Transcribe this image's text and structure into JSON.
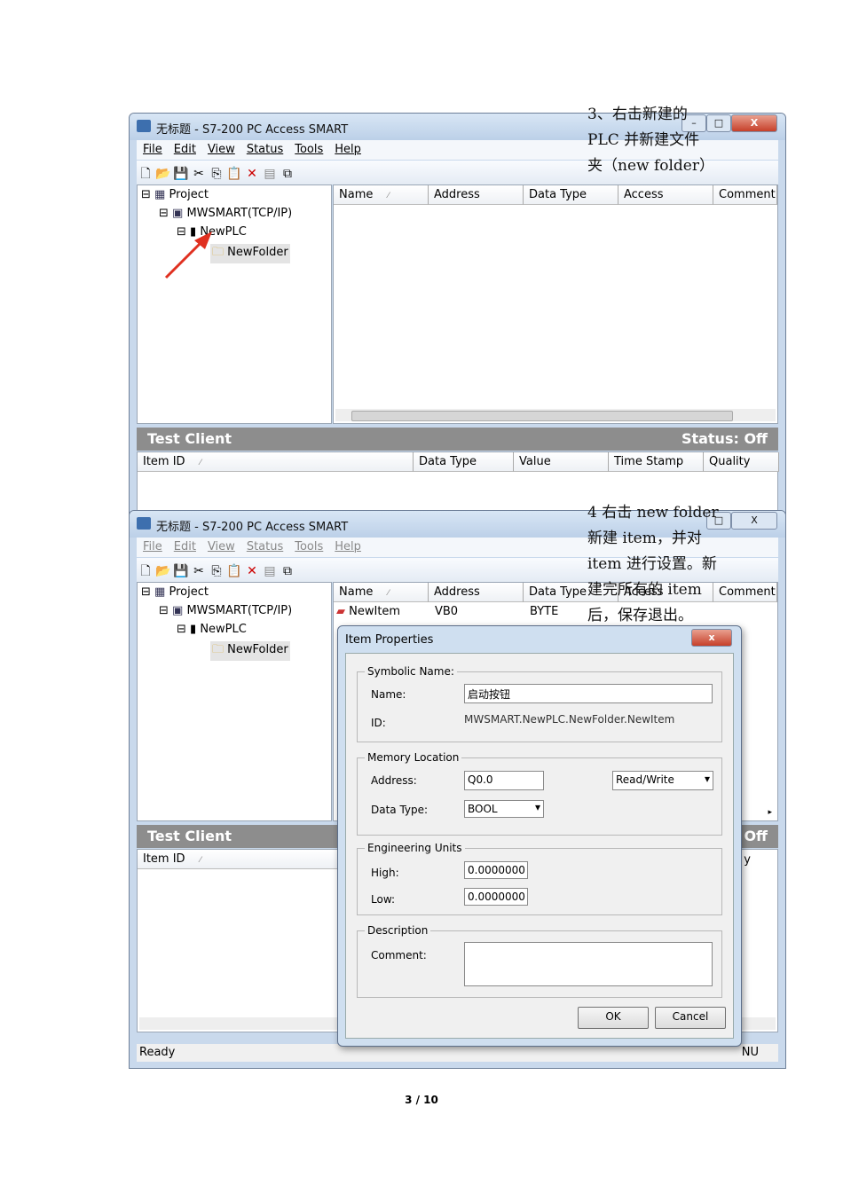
{
  "window": {
    "title": "无标题 - S7-200 PC Access SMART",
    "menu": [
      "File",
      "Edit",
      "View",
      "Status",
      "Tools",
      "Help"
    ]
  },
  "tree": {
    "project": "Project",
    "channel": "MWSMART(TCP/IP)",
    "plc": "NewPLC",
    "folder": "NewFolder"
  },
  "columns": [
    "Name",
    "Address",
    "Data Type",
    "Access",
    "Comment"
  ],
  "sort_mark": "⁄",
  "test_client": {
    "title": "Test Client",
    "status": "Status: Off",
    "columns": [
      "Item ID",
      "Data Type",
      "Value",
      "Time Stamp",
      "Quality"
    ]
  },
  "item_row": {
    "name": "NewItem",
    "address": "VB0",
    "type": "BYTE"
  },
  "annotation1": [
    "3、右击新建的",
    "PLC 并新建文件",
    "夹（new folder）"
  ],
  "annotation2": [
    "4  右击 new folder",
    "新建 item，并对",
    "item 进行设置。新",
    "建完所有的 item",
    "后，保存退出。"
  ],
  "dialog": {
    "title": "Item Properties",
    "symbolic": "Symbolic Name:",
    "name_label": "Name:",
    "name_value": "启动按钮",
    "id_label": "ID:",
    "id_value": "MWSMART.NewPLC.NewFolder.NewItem",
    "memory": "Memory Location",
    "address_label": "Address:",
    "address_value": "Q0.0",
    "access_value": "Read/Write",
    "datatype_label": "Data Type:",
    "datatype_value": "BOOL",
    "eng": "Engineering Units",
    "high_label": "High:",
    "high_value": "0.0000000",
    "low_label": "Low:",
    "low_value": "0.0000000",
    "desc": "Description",
    "comment_label": "Comment:",
    "ok": "OK",
    "cancel": "Cancel"
  },
  "statusbar": {
    "ready": "Ready",
    "num": "NU",
    "off_partial": "Off",
    "q_partial": "y"
  },
  "footer": "3 / 10"
}
